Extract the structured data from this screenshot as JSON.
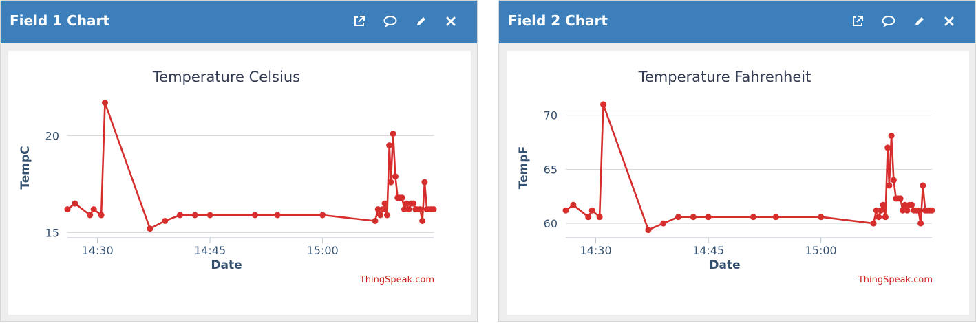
{
  "panels": [
    {
      "header_title": "Field 1 Chart",
      "header_icons": [
        "external-link-icon",
        "comment-icon",
        "pencil-icon",
        "close-icon"
      ],
      "credit": "ThingSpeak.com",
      "chart_data": {
        "type": "line",
        "title": "Temperature Celsius",
        "xlabel": "Date",
        "ylabel": "TempC",
        "x_ticks": [
          "14:30",
          "14:45",
          "15:00"
        ],
        "y_ticks": [
          "15",
          "20"
        ],
        "ylim": [
          14.8,
          21.9
        ],
        "grid": true,
        "color": "#d62d2d",
        "series": [
          {
            "x": [
              "14:26",
              "14:27",
              "14:29",
              "14:29.5",
              "14:30.5",
              "14:31",
              "14:37",
              "14:39",
              "14:41",
              "14:43",
              "14:45",
              "14:51",
              "14:54",
              "15:00",
              "15:07",
              "15:07.4",
              "15:07.7",
              "15:08",
              "15:08.3",
              "15:08.6",
              "15:08.9",
              "15:09.1",
              "15:09.4",
              "15:09.7",
              "15:10",
              "15:10.3",
              "15:10.6",
              "15:10.9",
              "15:11.2",
              "15:11.5",
              "15:11.8",
              "15:12.1",
              "15:12.4",
              "15:12.7",
              "15:13",
              "15:13.3",
              "15:13.6",
              "15:13.9",
              "15:14.2",
              "15:14.5",
              "15:14.8"
            ],
            "y": [
              16.2,
              16.5,
              15.9,
              16.2,
              15.9,
              21.7,
              15.2,
              15.6,
              15.9,
              15.9,
              15.9,
              15.9,
              15.9,
              15.9,
              15.6,
              16.2,
              15.9,
              16.2,
              16.5,
              15.9,
              19.5,
              17.6,
              20.1,
              17.9,
              16.8,
              16.8,
              16.8,
              16.2,
              16.5,
              16.2,
              16.5,
              16.5,
              16.2,
              16.2,
              16.2,
              15.6,
              17.6,
              16.2,
              16.2,
              16.2,
              16.2
            ]
          }
        ]
      }
    },
    {
      "header_title": "Field 2 Chart",
      "header_icons": [
        "external-link-icon",
        "comment-icon",
        "pencil-icon",
        "close-icon"
      ],
      "credit": "ThingSpeak.com",
      "chart_data": {
        "type": "line",
        "title": "Temperature Fahrenheit",
        "xlabel": "Date",
        "ylabel": "TempF",
        "x_ticks": [
          "14:30",
          "14:45",
          "15:00"
        ],
        "y_ticks": [
          "60",
          "65",
          "70"
        ],
        "ylim": [
          58.8,
          71.5
        ],
        "grid": true,
        "color": "#d62d2d",
        "series": [
          {
            "x": [
              "14:26",
              "14:27",
              "14:29",
              "14:29.5",
              "14:30.5",
              "14:31",
              "14:37",
              "14:39",
              "14:41",
              "14:43",
              "14:45",
              "14:51",
              "14:54",
              "15:00",
              "15:07",
              "15:07.4",
              "15:07.7",
              "15:08",
              "15:08.3",
              "15:08.6",
              "15:08.9",
              "15:09.1",
              "15:09.4",
              "15:09.7",
              "15:10",
              "15:10.3",
              "15:10.6",
              "15:10.9",
              "15:11.2",
              "15:11.5",
              "15:11.8",
              "15:12.1",
              "15:12.4",
              "15:12.7",
              "15:13",
              "15:13.3",
              "15:13.6",
              "15:13.9",
              "15:14.2",
              "15:14.5",
              "15:14.8"
            ],
            "y": [
              61.2,
              61.7,
              60.6,
              61.2,
              60.6,
              71.0,
              59.4,
              60.0,
              60.6,
              60.6,
              60.6,
              60.6,
              60.6,
              60.6,
              60.0,
              61.2,
              60.6,
              61.2,
              61.7,
              60.6,
              67.0,
              63.5,
              68.1,
              64.0,
              62.3,
              62.3,
              62.3,
              61.2,
              61.7,
              61.2,
              61.7,
              61.7,
              61.2,
              61.2,
              61.2,
              60.0,
              63.5,
              61.2,
              61.2,
              61.2,
              61.2
            ]
          }
        ]
      }
    }
  ]
}
